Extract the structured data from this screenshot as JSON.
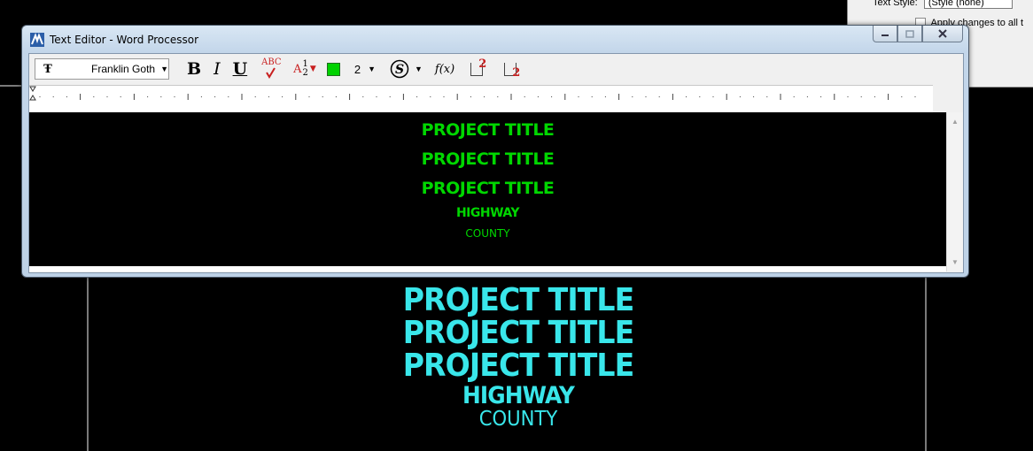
{
  "background_dialog": {
    "text_style_label": "Text Style:",
    "text_style_value": "(Style (none)",
    "apply_changes_label": "Apply changes to all t"
  },
  "window": {
    "title": "Text Editor - Word Processor"
  },
  "toolbar": {
    "font_name": "Franklin Goth",
    "bold_label": "B",
    "italic_label": "I",
    "underline_label": "U",
    "spell_label": "ABC",
    "fraction_prefix": "A",
    "fraction_num": "1",
    "fraction_den": "2",
    "color_hex": "#00d200",
    "weight_value": "2",
    "fx_label": "f(x)",
    "superscript_label": "2",
    "subscript_label": "2"
  },
  "editor": {
    "lines": [
      "PROJECT TITLE",
      "PROJECT TITLE",
      "PROJECT TITLE",
      "HIGHWAY",
      "COUNTY"
    ],
    "text_color": "#00d700"
  },
  "drawing": {
    "lines": [
      "PROJECT TITLE",
      "PROJECT TITLE",
      "PROJECT TITLE",
      "HIGHWAY",
      "COUNTY"
    ],
    "text_color": "#39e6ea"
  }
}
